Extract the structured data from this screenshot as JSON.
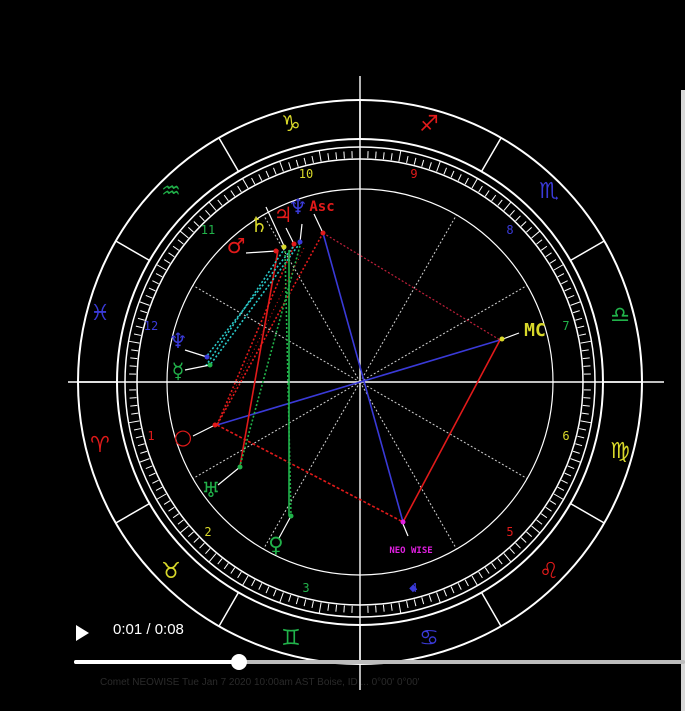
{
  "colors": {
    "background": "#000000",
    "wheel": "#ffffff",
    "fire": "#e11a1a",
    "earth": "#d8d82a",
    "air": "#21b24a",
    "water": "#3a3ad8",
    "trine": "#3a3ad8",
    "square": "#e11a1a",
    "neowise": "#e020e0"
  },
  "chart": {
    "signs": [
      {
        "name": "Capricorn",
        "symbol": "♑",
        "color": "#d8d82a"
      },
      {
        "name": "Sagittarius",
        "symbol": "♐",
        "color": "#e11a1a"
      },
      {
        "name": "Scorpio",
        "symbol": "♏",
        "color": "#3a3ad8"
      },
      {
        "name": "Libra",
        "symbol": "♎",
        "color": "#21b24a"
      },
      {
        "name": "Virgo",
        "symbol": "♍",
        "color": "#d8d82a"
      },
      {
        "name": "Leo",
        "symbol": "♌",
        "color": "#e11a1a"
      },
      {
        "name": "Cancer",
        "symbol": "♋",
        "color": "#3a3ad8"
      },
      {
        "name": "Gemini",
        "symbol": "♊",
        "color": "#21b24a"
      },
      {
        "name": "Taurus",
        "symbol": "♉",
        "color": "#d8d82a"
      },
      {
        "name": "Aries",
        "symbol": "♈",
        "color": "#e11a1a"
      },
      {
        "name": "Pisces",
        "symbol": "♓",
        "color": "#3a3ad8"
      },
      {
        "name": "Aquarius",
        "symbol": "♒",
        "color": "#21b24a"
      }
    ],
    "houses": [
      {
        "number": "10",
        "color": "#d8d82a"
      },
      {
        "number": "9",
        "color": "#e11a1a"
      },
      {
        "number": "8",
        "color": "#3a3ad8"
      },
      {
        "number": "7",
        "color": "#21b24a"
      },
      {
        "number": "6",
        "color": "#d8d82a"
      },
      {
        "number": "5",
        "color": "#e11a1a"
      },
      {
        "number": "4",
        "color": "#3a3ad8"
      },
      {
        "number": "3",
        "color": "#21b24a"
      },
      {
        "number": "2",
        "color": "#d8d82a"
      },
      {
        "number": "1",
        "color": "#e11a1a"
      },
      {
        "number": "12",
        "color": "#3a3ad8"
      },
      {
        "number": "11",
        "color": "#21b24a"
      }
    ],
    "points": [
      {
        "name": "sun",
        "symbol": "○",
        "color": "#e11a1a"
      },
      {
        "name": "mars",
        "symbol": "♂",
        "color": "#e11a1a"
      },
      {
        "name": "saturn",
        "symbol": "♄",
        "color": "#d8d82a"
      },
      {
        "name": "jupiter",
        "symbol": "♃",
        "color": "#e11a1a"
      },
      {
        "name": "neptune",
        "symbol": "♆",
        "color": "#3a3ad8"
      },
      {
        "name": "ascendant",
        "symbol": "Asc",
        "color": "#e11a1a"
      },
      {
        "name": "pluto",
        "symbol": "♆",
        "color": "#3a3ad8"
      },
      {
        "name": "mercury",
        "symbol": "☿",
        "color": "#21b24a"
      },
      {
        "name": "uranus",
        "symbol": "♅",
        "color": "#21b24a"
      },
      {
        "name": "venus",
        "symbol": "♀",
        "color": "#21b24a"
      },
      {
        "name": "midheaven",
        "symbol": "MC",
        "color": "#d8d82a"
      },
      {
        "name": "neowise",
        "symbol": "NEO WISE",
        "color": "#e020e0"
      }
    ]
  },
  "video": {
    "play_icon": "play-icon",
    "time": "0:01 / 0:08",
    "progress": 0.27,
    "caption": "Comet NEOWISE  Tue Jan  7 2020 10:00am  AST  Boise, ID ...  0°00'  0°00'"
  }
}
